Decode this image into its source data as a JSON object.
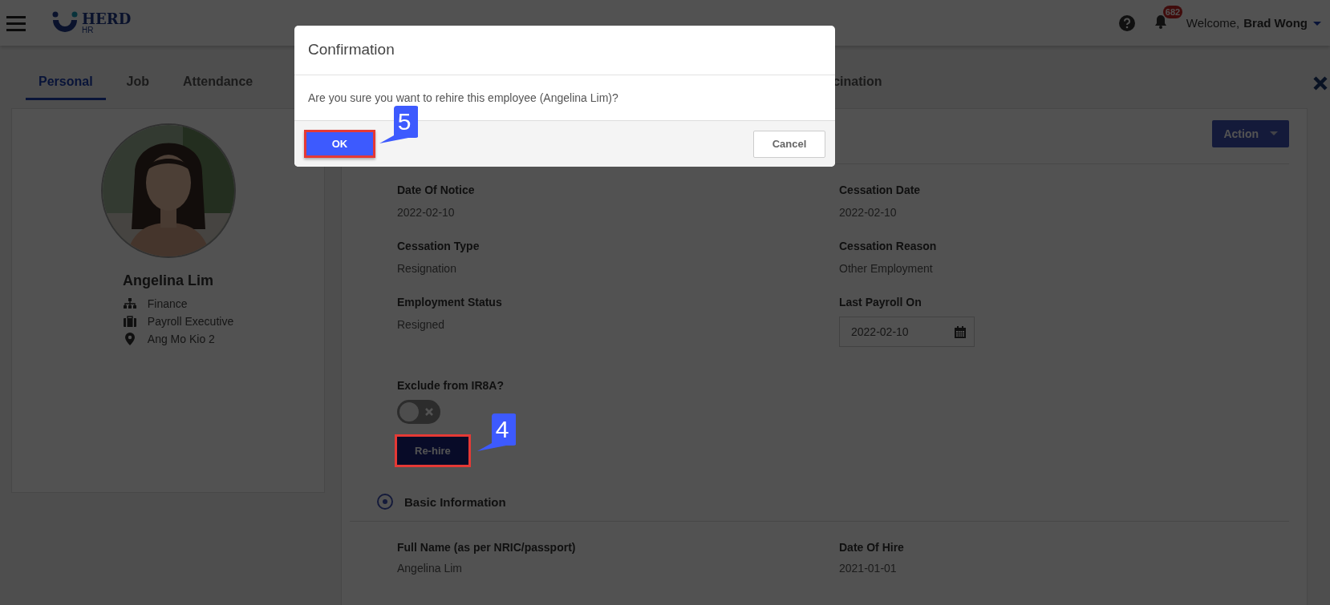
{
  "header": {
    "logo_text": "HERD",
    "logo_sub": "HR",
    "notification_count": "682",
    "welcome": "Welcome,",
    "user": "Brad Wong"
  },
  "tabs": [
    {
      "label": "Personal",
      "selected": true,
      "kind": "full"
    },
    {
      "label": "Job",
      "selected": false,
      "kind": "full"
    },
    {
      "label": "Attendance",
      "selected": false,
      "kind": "full"
    },
    {
      "label": "cination",
      "selected": false,
      "kind": "clipped"
    }
  ],
  "profile": {
    "name": "Angelina Lim",
    "details": [
      {
        "kind": "department",
        "text": "Finance"
      },
      {
        "kind": "position",
        "text": "Payroll Executive"
      },
      {
        "kind": "location",
        "text": "Ang Mo Kio 2"
      }
    ]
  },
  "action_button": "Action",
  "fields": [
    {
      "label": "Date Of Notice",
      "value": "2022-02-10",
      "kind": "text"
    },
    {
      "label": "Cessation Date",
      "value": "2022-02-10",
      "kind": "text"
    },
    {
      "label": "Cessation Type",
      "value": "Resignation",
      "kind": "text"
    },
    {
      "label": "Cessation Reason",
      "value": "Other Employment",
      "kind": "text"
    },
    {
      "label": "Employment Status",
      "value": "Resigned",
      "kind": "text"
    },
    {
      "label": "Last Payroll On",
      "value": "2022-02-10",
      "kind": "date"
    }
  ],
  "toggle": {
    "label": "Exclude from IR8A?",
    "on": false
  },
  "rehire_button": "Re-hire",
  "section": {
    "title": "Basic Information",
    "fields": [
      {
        "label": "Full Name (as per NRIC/passport)",
        "value": "Angelina Lim"
      },
      {
        "label": "Date Of Hire",
        "value": "2021-01-01"
      }
    ]
  },
  "dialog": {
    "title": "Confirmation",
    "message": "Are you sure you want to rehire this employee (Angelina Lim)?",
    "ok": "OK",
    "cancel": "Cancel"
  },
  "callouts": [
    "5",
    "4"
  ]
}
